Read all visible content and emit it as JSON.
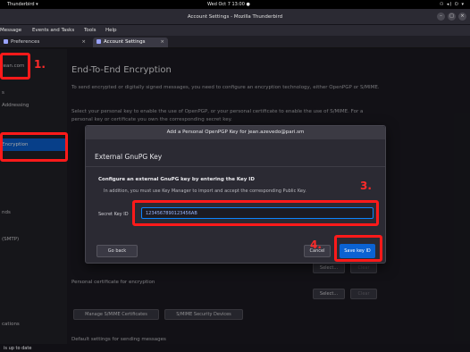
{
  "topbar": {
    "app_name": "Thunderbird ▾",
    "clock": "Wed Oct 7  13:00 ●",
    "system_icons": "⚇ ◂) ⏻ ▾"
  },
  "window": {
    "title": "Account Settings - Mozilla Thunderbird"
  },
  "menubar": {
    "items": [
      "Message",
      "Events and Tasks",
      "Tools",
      "Help"
    ]
  },
  "tabs": [
    {
      "label": "Preferences"
    },
    {
      "label": "Account Settings"
    }
  ],
  "sidebar": {
    "items": [
      {
        "label": "Jean.com"
      },
      {
        "label": "s"
      },
      {
        "label": "Addressing"
      },
      {
        "label": "Encryption"
      },
      {
        "label": "nds"
      },
      {
        "label": "(SMTP)"
      },
      {
        "label": "cations"
      }
    ]
  },
  "main": {
    "heading": "End-To-End Encryption",
    "para1": "To send encrypted or digitally signed messages, you need to configure an encryption technology, either OpenPGP or S/MIME.",
    "para2": "Select your personal key to enable the use of OpenPGP, or your personal certificate to enable the use of S/MIME. For a personal key or certificate you own the corresponding secret key.",
    "personal_cert_label": "Personal certificate for encryption",
    "select_label": "Select...",
    "clear_label": "Clear",
    "manage_certs_label": "Manage S/MIME Certificates",
    "security_devices_label": "S/MIME Security Devices",
    "default_settings_label": "Default settings for sending messages"
  },
  "dialog": {
    "title": "Add a Personal OpenPGP Key for jean.azevedo@pari.sm",
    "heading": "External GnuPG Key",
    "bold_text": "Configure an external GnuPG key by entering the Key ID",
    "note": "In addition, you must use Key Manager to import and accept the corresponding Public Key.",
    "secret_key_label": "Secret Key ID",
    "secret_key_value": "1234567890123456AB",
    "go_back_label": "Go back",
    "cancel_label": "Cancel",
    "save_label": "Save key ID"
  },
  "annotations": {
    "step1": "1.",
    "step2": "2.",
    "step3": "3.",
    "step4": "4."
  },
  "statusbar": {
    "text": "is up to date"
  },
  "colors": {
    "accent": "#0b62d3",
    "annotation": "#ff1a1a"
  }
}
